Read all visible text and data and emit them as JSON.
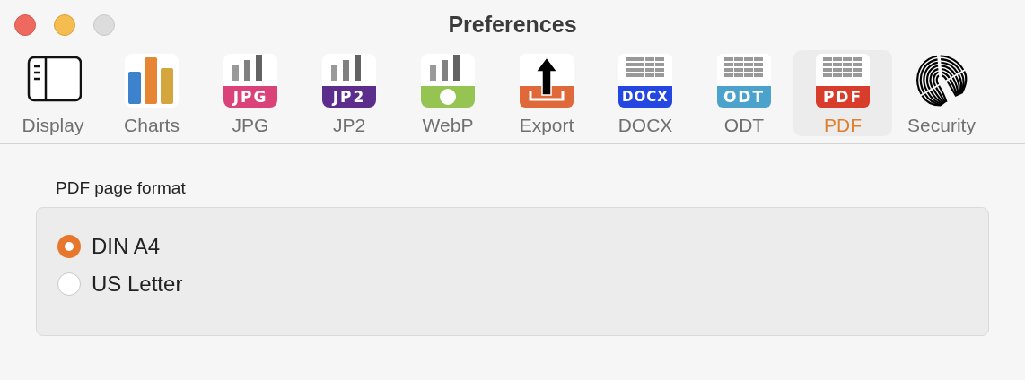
{
  "window": {
    "title": "Preferences"
  },
  "tabs": [
    {
      "label": "Display",
      "kind": "display",
      "selected": false
    },
    {
      "label": "Charts",
      "kind": "charts",
      "selected": false
    },
    {
      "label": "JPG",
      "kind": "image",
      "badge": "JPG",
      "color": "#d9437a",
      "selected": false
    },
    {
      "label": "JP2",
      "kind": "image",
      "badge": "JP2",
      "color": "#5c2d8a",
      "selected": false
    },
    {
      "label": "WebP",
      "kind": "image-dot",
      "color": "#95c452",
      "selected": false
    },
    {
      "label": "Export",
      "kind": "export",
      "color": "#e0693a",
      "selected": false
    },
    {
      "label": "DOCX",
      "kind": "table",
      "badge": "DOCX",
      "color": "#2347e0",
      "selected": false
    },
    {
      "label": "ODT",
      "kind": "table",
      "badge": "ODT",
      "color": "#4ba3cc",
      "selected": false
    },
    {
      "label": "PDF",
      "kind": "table",
      "badge": "PDF",
      "color": "#d83c2a",
      "selected": true
    },
    {
      "label": "Security",
      "kind": "security",
      "selected": false
    }
  ],
  "section": {
    "title": "PDF page format",
    "options": [
      {
        "label": "DIN A4",
        "selected": true
      },
      {
        "label": "US Letter",
        "selected": false
      }
    ]
  }
}
